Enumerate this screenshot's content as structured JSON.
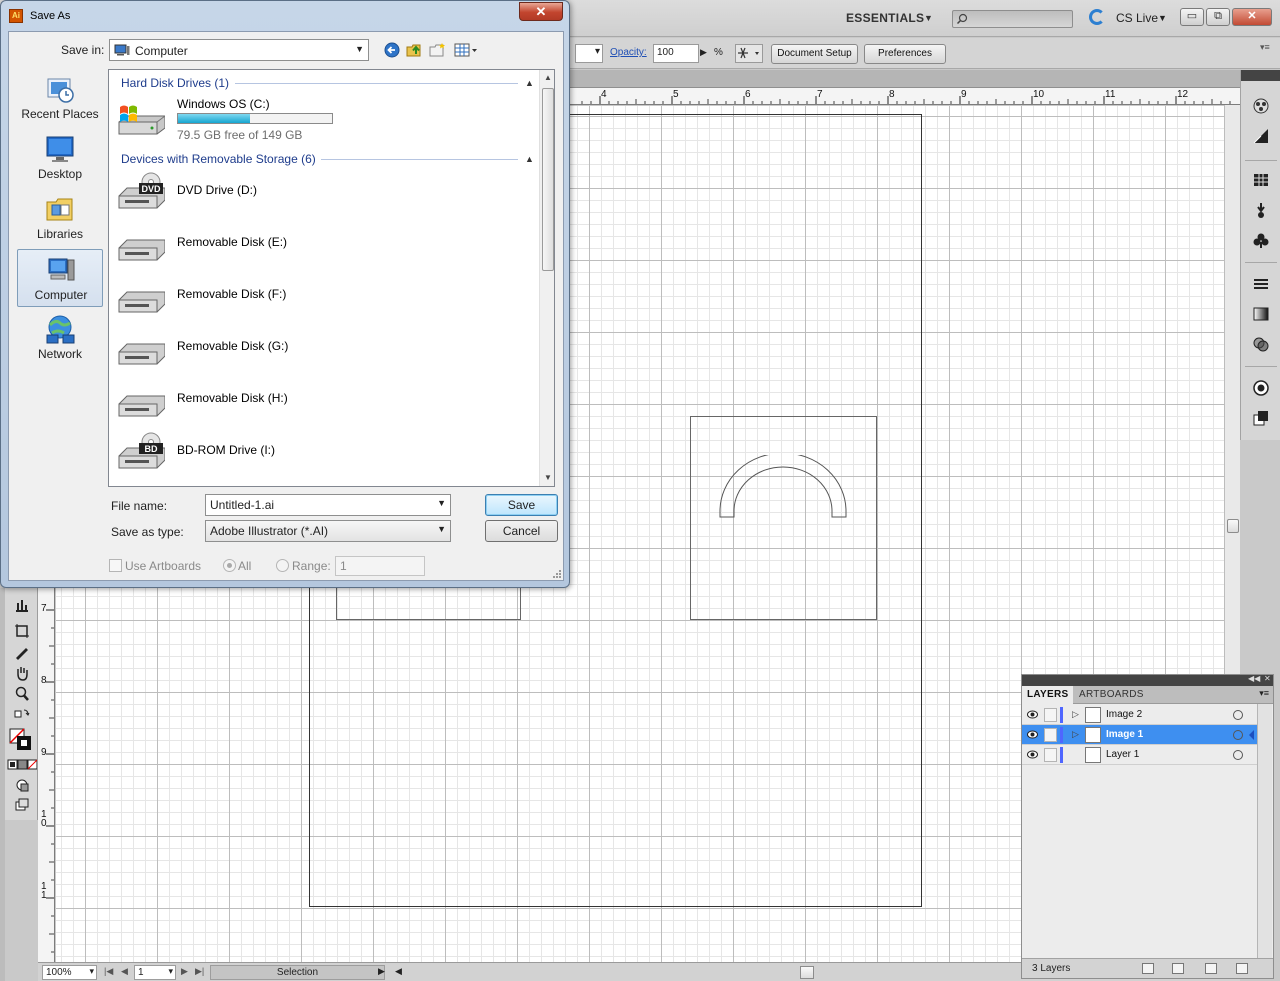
{
  "app": {
    "workspace": "ESSENTIALS",
    "search_placeholder": "",
    "cs_live": "CS Live",
    "window_buttons": {
      "minimize": "▭",
      "restore": "⧉",
      "close": "✕"
    }
  },
  "control_bar": {
    "opacity_label": "Opacity:",
    "opacity_value": "100",
    "opacity_unit": "%",
    "document_setup": "Document Setup",
    "preferences": "Preferences"
  },
  "rulers": {
    "horizontal": [
      "4",
      "5",
      "6",
      "7",
      "8",
      "9",
      "10",
      "11",
      "12"
    ],
    "vertical": [
      "7",
      "8",
      "9",
      "1 0",
      "1 1"
    ]
  },
  "status_bar": {
    "zoom": "100%",
    "page": "1",
    "mode": "Selection"
  },
  "layers_panel": {
    "tabs": [
      "LAYERS",
      "ARTBOARDS"
    ],
    "layers": [
      {
        "name": "Image 2",
        "selected": false,
        "has_children": true
      },
      {
        "name": "Image 1",
        "selected": true,
        "has_children": true
      },
      {
        "name": "Layer 1",
        "selected": false,
        "has_children": false
      }
    ],
    "count": "3 Layers",
    "layer_color": "#4f66ff"
  },
  "dialog": {
    "title": "Save As",
    "app_icon": "Ai",
    "close": "✕",
    "save_in_label": "Save in:",
    "save_in_value": "Computer",
    "places": [
      {
        "label": "Recent Places",
        "icon": "recent-places-icon",
        "active": false
      },
      {
        "label": "Desktop",
        "icon": "desktop-icon",
        "active": false
      },
      {
        "label": "Libraries",
        "icon": "libraries-icon",
        "active": false
      },
      {
        "label": "Computer",
        "icon": "computer-icon",
        "active": true
      },
      {
        "label": "Network",
        "icon": "network-icon",
        "active": false
      }
    ],
    "groups": {
      "hard_disks": "Hard Disk Drives (1)",
      "removable": "Devices with Removable Storage (6)"
    },
    "hard_disk": {
      "name": "Windows OS (C:)",
      "free_text": "79.5 GB free of 149 GB",
      "used_fraction": 0.47
    },
    "removable_drives": [
      {
        "name": "DVD Drive (D:)",
        "badge": "DVD",
        "icon": "dvd-drive-icon"
      },
      {
        "name": "Removable Disk (E:)",
        "badge": "",
        "icon": "removable-disk-icon"
      },
      {
        "name": "Removable Disk (F:)",
        "badge": "",
        "icon": "removable-disk-icon"
      },
      {
        "name": "Removable Disk (G:)",
        "badge": "",
        "icon": "removable-disk-icon"
      },
      {
        "name": "Removable Disk (H:)",
        "badge": "",
        "icon": "removable-disk-icon"
      },
      {
        "name": "BD-ROM Drive (I:)",
        "badge": "BD",
        "icon": "bd-rom-drive-icon"
      }
    ],
    "file_name_label": "File name:",
    "file_name_value": "Untitled-1.ai",
    "save_type_label": "Save as type:",
    "save_type_value": "Adobe Illustrator (*.AI)",
    "save_button": "Save",
    "cancel_button": "Cancel",
    "use_artboards": "Use Artboards",
    "all_label": "All",
    "range_label": "Range:",
    "range_value": "1"
  }
}
